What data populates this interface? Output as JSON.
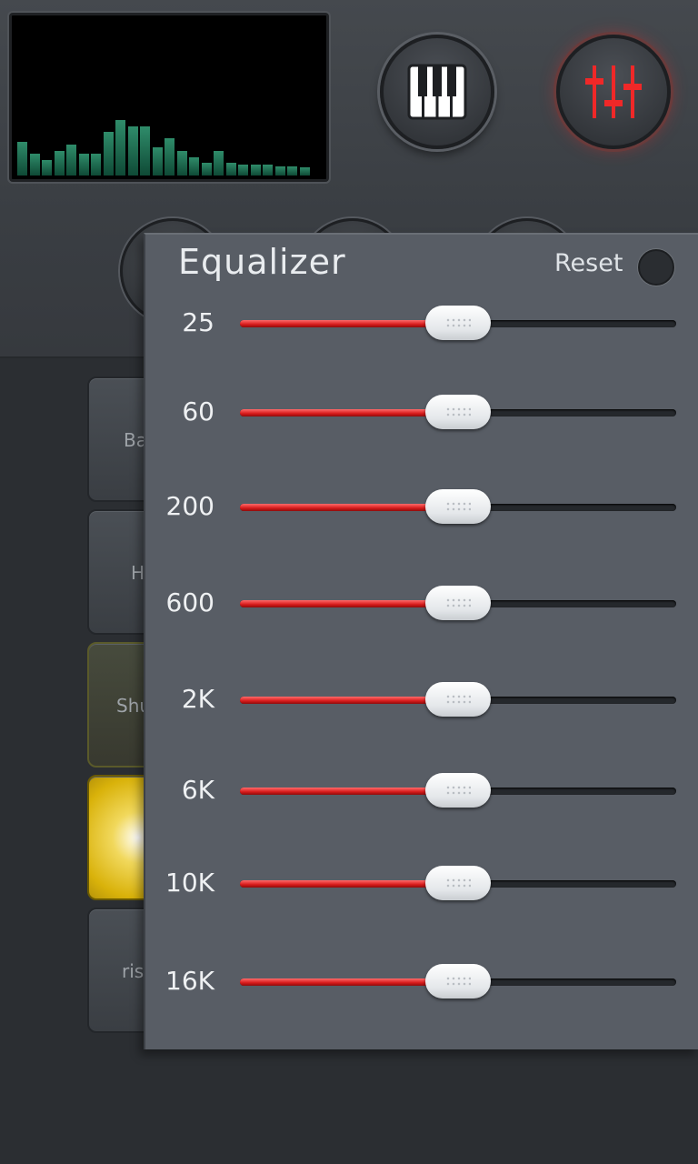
{
  "visualizer": {
    "levels": [
      0.22,
      0.14,
      0.1,
      0.16,
      0.2,
      0.14,
      0.14,
      0.28,
      0.36,
      0.32,
      0.32,
      0.18,
      0.24,
      0.16,
      0.12,
      0.08,
      0.16,
      0.08,
      0.07,
      0.07,
      0.07,
      0.06,
      0.06,
      0.05
    ],
    "color": "#1f6b4f"
  },
  "header_buttons": [
    {
      "name": "piano-button",
      "icon": "piano-keys-icon",
      "active": false
    },
    {
      "name": "mixer-button",
      "icon": "sliders-icon",
      "active": true,
      "accent": "#e02020"
    }
  ],
  "pads": [
    {
      "label": "Ba"
    },
    {
      "label": "H"
    },
    {
      "label": "Shu"
    },
    {
      "label": ""
    },
    {
      "label": "ris"
    }
  ],
  "equalizer": {
    "title": "Equalizer",
    "reset_label": "Reset",
    "accent": "#d61a1a",
    "bands": [
      {
        "label": "25",
        "value": 0.5
      },
      {
        "label": "60",
        "value": 0.5
      },
      {
        "label": "200",
        "value": 0.5
      },
      {
        "label": "600",
        "value": 0.5
      },
      {
        "label": "2K",
        "value": 0.5
      },
      {
        "label": "6K",
        "value": 0.5
      },
      {
        "label": "10K",
        "value": 0.5
      },
      {
        "label": "16K",
        "value": 0.5
      }
    ]
  }
}
